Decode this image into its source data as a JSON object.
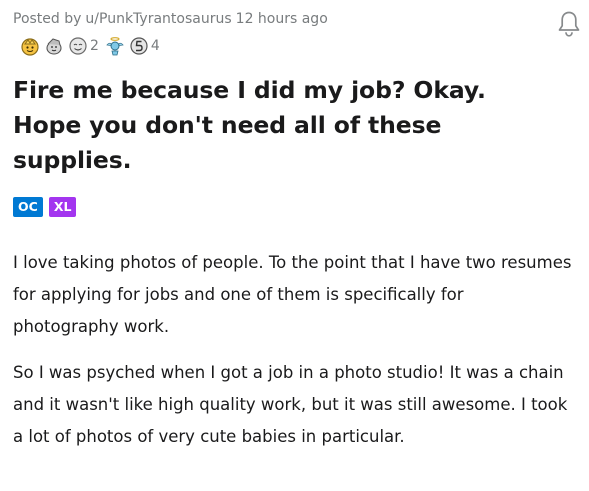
{
  "post": {
    "posted_by_prefix": "Posted by",
    "author": "u/PunkTyrantosaurus",
    "time": "12 hours ago",
    "title": "Fire me because I did my job? Okay. Hope you don't need all of these supplies.",
    "flairs": [
      {
        "label": "OC",
        "color": "#0079d3"
      },
      {
        "label": "XL",
        "color": "#a335ef"
      }
    ],
    "paragraphs": [
      "I love taking photos of people. To the point that I have two resumes for applying for jobs and one of them is specifically for photography work.",
      "So I was psyched when I got a job in a photo studio! It was a chain and it wasn't like high quality work, but it was still awesome. I took a lot of photos of very cute babies in particular."
    ]
  },
  "awards": [
    {
      "icon": "gold-helmet-award-icon",
      "count": null
    },
    {
      "icon": "wholesome-seal-award-icon",
      "count": null
    },
    {
      "icon": "silver-face-award-icon",
      "count": "2"
    },
    {
      "icon": "angel-award-icon",
      "count": null
    },
    {
      "icon": "rocket-like-award-icon",
      "count": "4"
    }
  ],
  "colors": {
    "meta_text": "#787c7e",
    "title_text": "#1a1a1b",
    "flair_oc": "#0079d3",
    "flair_xl": "#a335ef"
  }
}
